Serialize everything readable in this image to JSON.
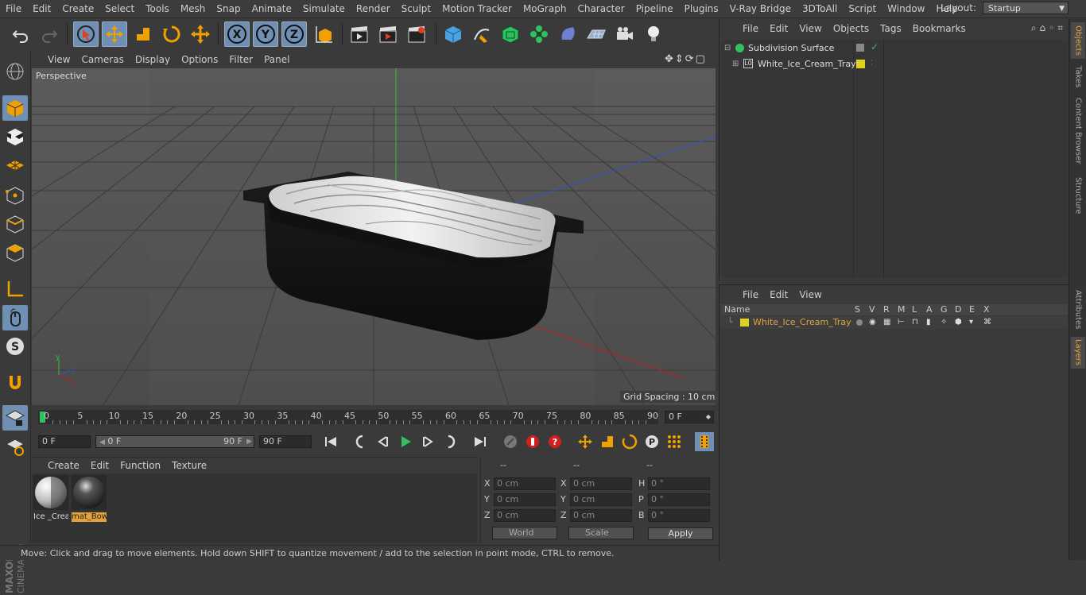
{
  "menubar": {
    "items": [
      "File",
      "Edit",
      "Create",
      "Select",
      "Tools",
      "Mesh",
      "Snap",
      "Animate",
      "Simulate",
      "Render",
      "Sculpt",
      "Motion Tracker",
      "MoGraph",
      "Character",
      "Pipeline",
      "Plugins",
      "V-Ray Bridge",
      "3DToAll",
      "Script",
      "Window",
      "Help"
    ],
    "layout_label": "Layout:",
    "layout_value": "Startup"
  },
  "viewport": {
    "menu": [
      "View",
      "Cameras",
      "Display",
      "Options",
      "Filter",
      "Panel"
    ],
    "label": "Perspective",
    "grid_spacing": "Grid Spacing : 10 cm"
  },
  "timeline": {
    "ticks": [
      "0",
      "5",
      "10",
      "15",
      "20",
      "25",
      "30",
      "35",
      "40",
      "45",
      "50",
      "55",
      "60",
      "65",
      "70",
      "75",
      "80",
      "85",
      "90"
    ],
    "current_frame": "0 F"
  },
  "transport": {
    "start_field": "0 F",
    "range_start": "0 F",
    "range_end": "90 F",
    "end_field": "90 F"
  },
  "materials": {
    "menu": [
      "Create",
      "Edit",
      "Function",
      "Texture"
    ],
    "items": [
      {
        "label": "Ice _Crea"
      },
      {
        "label": "mat_Bow"
      }
    ]
  },
  "coordinates": {
    "headers": [
      "--",
      "--",
      "--"
    ],
    "rows": [
      {
        "l1": "X",
        "v1": "0 cm",
        "l2": "X",
        "v2": "0 cm",
        "l3": "H",
        "v3": "0 °"
      },
      {
        "l1": "Y",
        "v1": "0 cm",
        "l2": "Y",
        "v2": "0 cm",
        "l3": "P",
        "v3": "0 °"
      },
      {
        "l1": "Z",
        "v1": "0 cm",
        "l2": "Z",
        "v2": "0 cm",
        "l3": "B",
        "v3": "0 °"
      }
    ],
    "world": "World",
    "scale": "Scale",
    "apply": "Apply"
  },
  "status": "Move: Click and drag to move elements. Hold down SHIFT to quantize movement / add to the selection in point mode, CTRL to remove.",
  "objects": {
    "menu": [
      "File",
      "Edit",
      "View",
      "Objects",
      "Tags",
      "Bookmarks"
    ],
    "rows": [
      {
        "name": "Subdivision Surface"
      },
      {
        "name": "White_Ice_Cream_Tray"
      }
    ]
  },
  "layers": {
    "menu": [
      "File",
      "Edit",
      "View"
    ],
    "columns": [
      "Name",
      "S",
      "V",
      "R",
      "M",
      "L",
      "A",
      "G",
      "D",
      "E",
      "X"
    ],
    "row_name": "White_Ice_Cream_Tray",
    "row_color": "#e0d020"
  },
  "right_tabs": [
    "Objects",
    "Takes",
    "Content Browser",
    "Structure",
    "Attributes",
    "Layers"
  ],
  "colors": {
    "accent": "#6f8fb5",
    "highlight": "#e3a33a"
  }
}
